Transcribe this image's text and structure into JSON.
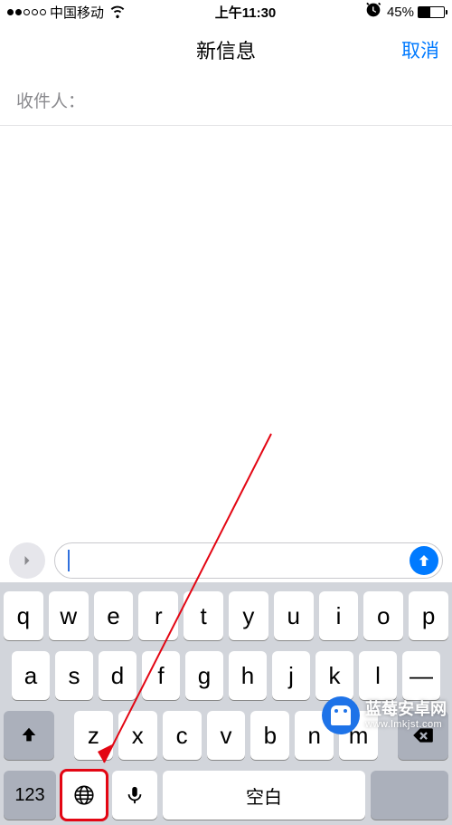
{
  "status": {
    "carrier": "中国移动",
    "time": "上午11:30",
    "battery_pct": "45%"
  },
  "nav": {
    "title": "新信息",
    "cancel": "取消"
  },
  "recipient": {
    "label": "收件人："
  },
  "message_input": {
    "value": "",
    "placeholder": ""
  },
  "keyboard": {
    "row1": [
      "q",
      "w",
      "e",
      "r",
      "t",
      "y",
      "u",
      "i",
      "o",
      "p"
    ],
    "row2": [
      "a",
      "s",
      "d",
      "f",
      "g",
      "h",
      "j",
      "k",
      "l",
      "—"
    ],
    "row3": [
      "z",
      "x",
      "c",
      "v",
      "b",
      "n",
      "m"
    ],
    "num_label": "123",
    "space_label": "空白",
    "return_label": ""
  },
  "watermark": {
    "title": "蓝莓安卓网",
    "url": "www.lmkjst.com"
  },
  "annotation": {
    "highlighted_key": "globe-key"
  }
}
